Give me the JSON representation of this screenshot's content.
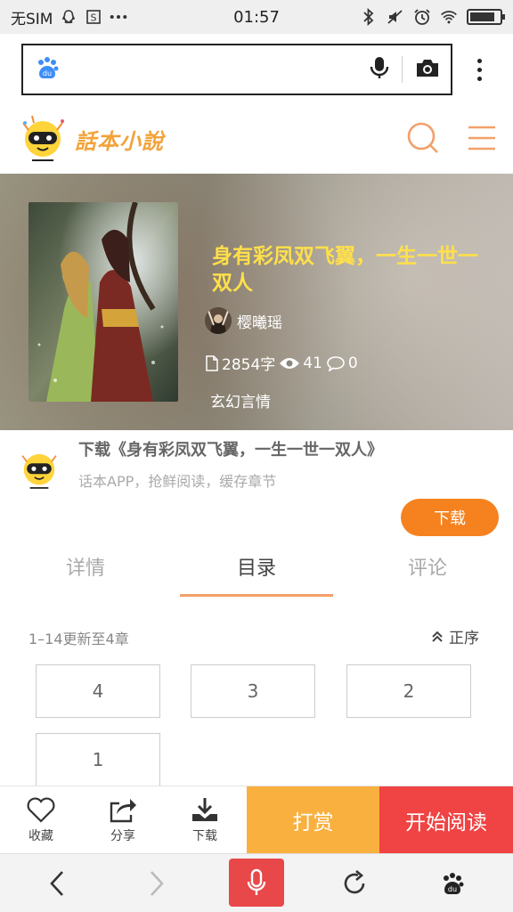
{
  "status_bar": {
    "carrier": "无SIM",
    "time": "01:57",
    "battery_level": 0.85
  },
  "browser": {
    "url": "",
    "icons": [
      "baidu-paw-icon",
      "mic-icon",
      "camera-icon",
      "more-vertical-icon"
    ]
  },
  "site": {
    "logo_text": "話本小說",
    "icons": [
      "search-icon",
      "menu-icon"
    ],
    "accent_color": "#f2a06a"
  },
  "book": {
    "title": "身有彩凤双飞翼，一生一世一双人",
    "author": "樱曦瑶",
    "word_count": "2854字",
    "views": "41",
    "comments": "0",
    "genre": "玄幻言情",
    "title_color": "#ffe04a"
  },
  "promo": {
    "title": "下载《身有彩凤双飞翼，一生一世一双人》",
    "subtitle": "话本APP，抢鲜阅读，缓存章节",
    "button": "下载",
    "button_color": "#f5821f"
  },
  "tabs": [
    {
      "label": "详情",
      "active": false
    },
    {
      "label": "目录",
      "active": true
    },
    {
      "label": "评论",
      "active": false
    }
  ],
  "chapters": {
    "summary": "1–14更新至4章",
    "sort_label": "正序",
    "items": [
      "4",
      "3",
      "2",
      "1"
    ]
  },
  "action_bar": {
    "favorite": "收藏",
    "share": "分享",
    "download": "下载",
    "reward": "打赏",
    "read": "开始阅读",
    "reward_color": "#f9b03f",
    "read_color": "#f04343"
  },
  "browser_nav": {
    "icons": [
      "back-icon",
      "forward-icon",
      "voice-icon",
      "refresh-icon",
      "baidu-paw-icon"
    ]
  }
}
